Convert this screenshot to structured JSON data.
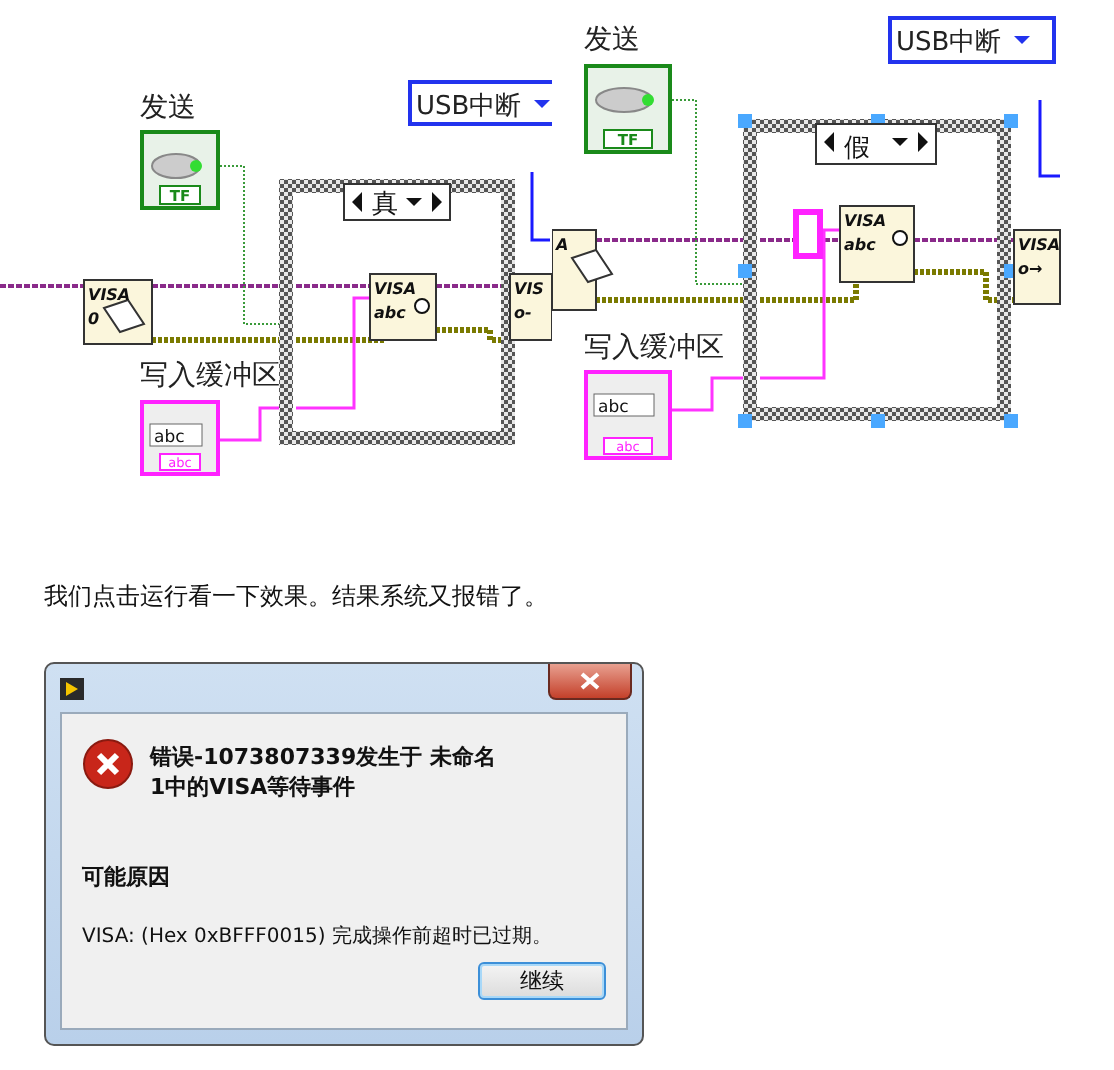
{
  "diagrams": [
    {
      "button_label": "发送",
      "button_terminal": "TF",
      "enum_value": "USB中断",
      "case_selector": "真",
      "case_selected": false,
      "string_label": "写入缓冲区",
      "string_value": "abc",
      "string_terminal": "abc",
      "nodes": [
        {
          "kind": "open",
          "texts": [
            "VISA",
            "0"
          ]
        },
        {
          "kind": "write",
          "texts": [
            "VISA",
            "abc"
          ]
        },
        {
          "kind": "close",
          "texts": [
            "VIS",
            "o-"
          ]
        }
      ]
    },
    {
      "button_label": "发送",
      "button_terminal": "TF",
      "enum_value": "USB中断",
      "case_selector": "假",
      "case_selected": true,
      "empty_string_constant": true,
      "string_label": "写入缓冲区",
      "string_value": "abc",
      "string_terminal": "abc",
      "nodes": [
        {
          "kind": "open",
          "texts": [
            "A"
          ]
        },
        {
          "kind": "write",
          "texts": [
            "VISA",
            "abc"
          ]
        },
        {
          "kind": "close",
          "texts": [
            "VISA",
            "o→"
          ]
        }
      ]
    }
  ],
  "paragraph": "我们点击运行看一下效果。结果系统又报错了。",
  "dialog": {
    "message_lines": [
      "错误-1073807339发生于 未命名",
      "1中的VISA等待事件"
    ],
    "section_title": "可能原因",
    "detail": "VISA:  (Hex 0xBFFF0015) 完成操作前超时已过期。",
    "buttons": [
      {
        "label": "继续",
        "default": true
      }
    ]
  }
}
